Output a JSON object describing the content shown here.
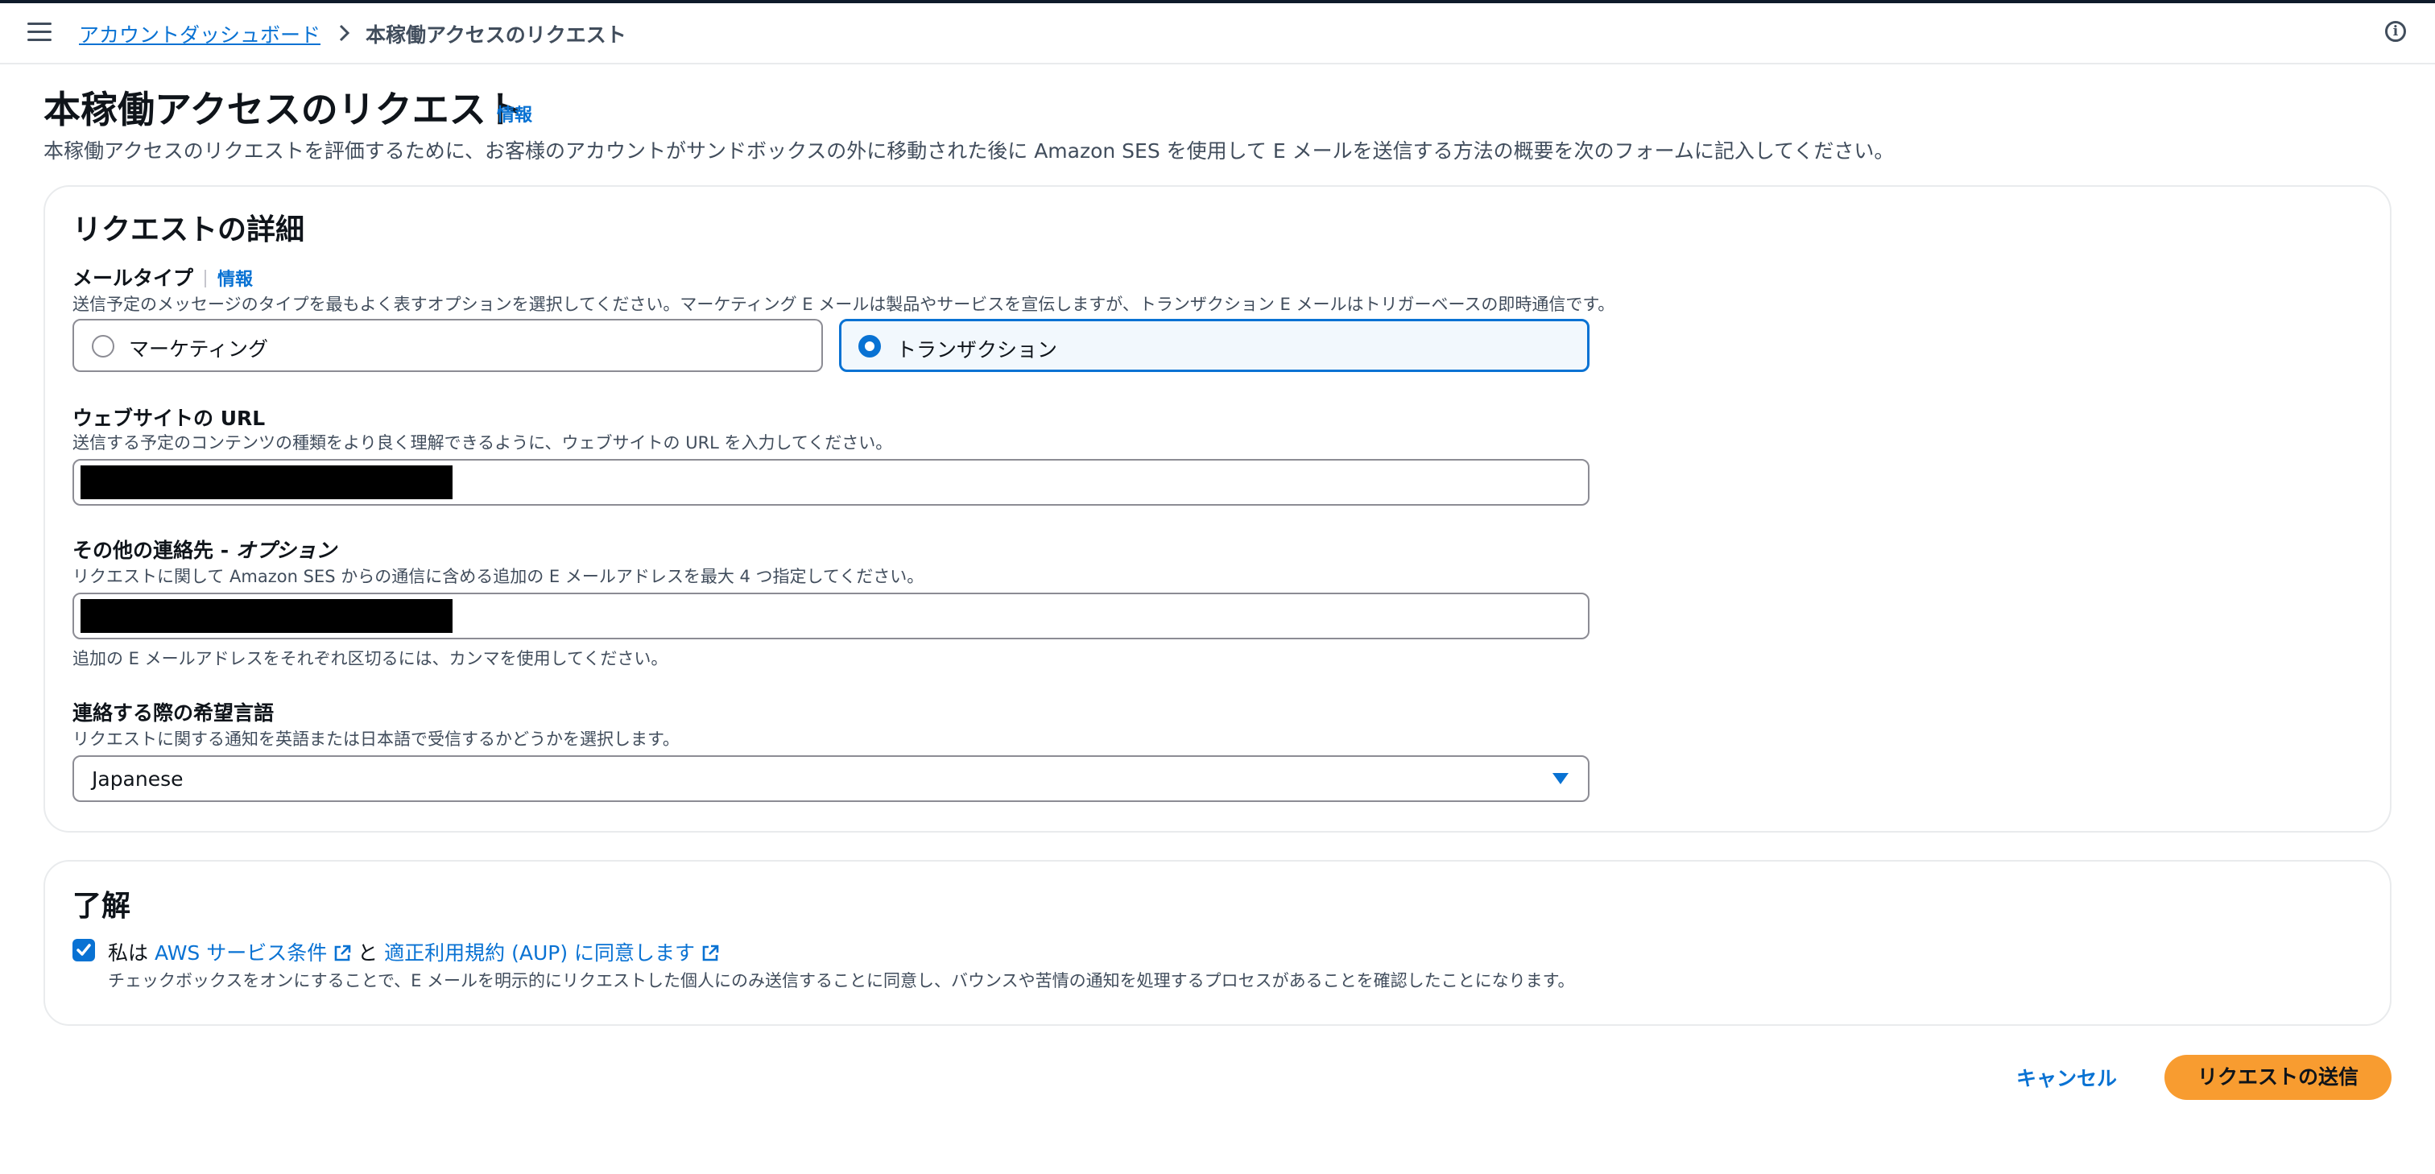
{
  "breadcrumb": {
    "parent": "アカウントダッシュボード",
    "current": "本稼働アクセスのリクエスト"
  },
  "header": {
    "title": "本稼働アクセスのリクエスト",
    "info_link": "情報",
    "description": "本稼働アクセスのリクエストを評価するために、お客様のアカウントがサンドボックスの外に移動された後に Amazon SES を使用して E メールを送信する方法の概要を次のフォームに記入してください。"
  },
  "details": {
    "section_title": "リクエストの詳細",
    "mail_type": {
      "label": "メールタイプ",
      "info_link": "情報",
      "description": "送信予定のメッセージのタイプを最もよく表すオプションを選択してください。マーケティング E メールは製品やサービスを宣伝しますが、トランザクション E メールはトリガーベースの即時通信です。",
      "options": [
        "マーケティング",
        "トランザクション"
      ],
      "selected": "トランザクション"
    },
    "website_url": {
      "label": "ウェブサイトの URL",
      "description": "送信する予定のコンテンツの種類をより良く理解できるように、ウェブサイトの URL を入力してください。"
    },
    "other_contacts": {
      "label": "その他の連絡先 - ",
      "label_optional": "オプション",
      "description": "リクエストに関して Amazon SES からの通信に含める追加の E メールアドレスを最大 4 つ指定してください。",
      "hint": "追加の E メールアドレスをそれぞれ区切るには、カンマを使用してください。"
    },
    "language": {
      "label": "連絡する際の希望言語",
      "description": "リクエストに関する通知を英語または日本語で受信するかどうかを選択します。",
      "value": "Japanese"
    }
  },
  "acknowledgement": {
    "section_title": "了解",
    "checked": true,
    "prefix": "私は ",
    "link1": "AWS サービス条件",
    "middle": " と ",
    "link2": "適正利用規約 (AUP) に同意します",
    "description": "チェックボックスをオンにすることで、E メールを明示的にリクエストした個人にのみ送信することに同意し、バウンスや苦情の通知を処理するプロセスがあることを確認したことになります。"
  },
  "actions": {
    "cancel": "キャンセル",
    "submit": "リクエストの送信"
  },
  "colors": {
    "link": "#0972d3",
    "primary_button": "#f89c30"
  }
}
